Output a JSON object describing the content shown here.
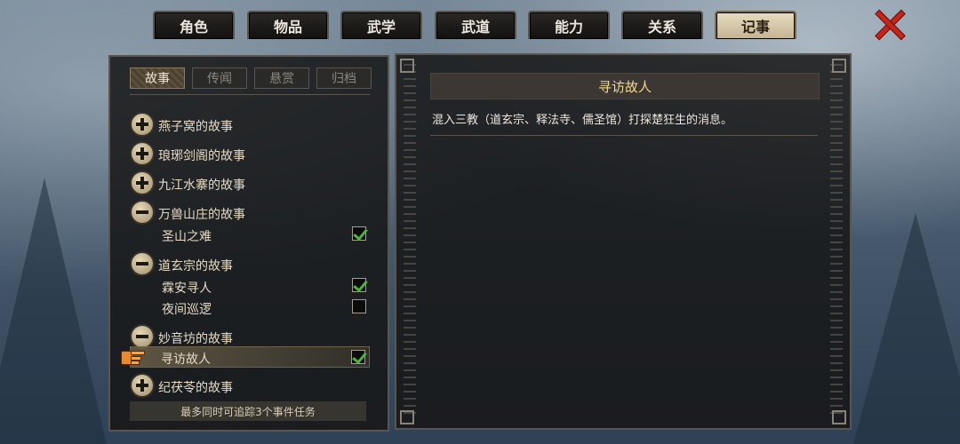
{
  "tabs": [
    "角色",
    "物品",
    "武学",
    "武道",
    "能力",
    "关系",
    "记事"
  ],
  "active_tab": "记事",
  "close_icon": "close-x-icon",
  "subtabs": [
    "故事",
    "传闻",
    "悬赏",
    "归档"
  ],
  "active_subtab": "故事",
  "stories": {
    "g1": {
      "label": "燕子窝的故事",
      "state": "collapsed"
    },
    "g2": {
      "label": "琅琊剑阁的故事",
      "state": "collapsed"
    },
    "g3": {
      "label": "九江水寨的故事",
      "state": "collapsed"
    },
    "g4": {
      "label": "万兽山庄的故事",
      "state": "expanded",
      "items": [
        {
          "label": "圣山之难",
          "tracked": true
        }
      ]
    },
    "g5": {
      "label": "道玄宗的故事",
      "state": "expanded",
      "items": [
        {
          "label": "霖安寻人",
          "tracked": true
        },
        {
          "label": "夜间巡逻",
          "tracked": false
        }
      ]
    },
    "g6": {
      "label": "妙音坊的故事",
      "state": "expanded",
      "items": [
        {
          "label": "寻访故人",
          "tracked": true,
          "selected": true
        }
      ]
    },
    "g7": {
      "label": "纪茯苓的故事",
      "state": "collapsed"
    }
  },
  "footer_text": "最多同时可追踪3个事件任务",
  "quest": {
    "title": "寻访故人",
    "description": "混入三教（道玄宗、释法寺、儒圣馆）打探楚狂生的消息。"
  },
  "pointer_icon": "pointing-hand-icon",
  "colors": {
    "accent_gold": "#f0d890",
    "check_green": "#4fb342",
    "close_red": "#c2261c"
  }
}
